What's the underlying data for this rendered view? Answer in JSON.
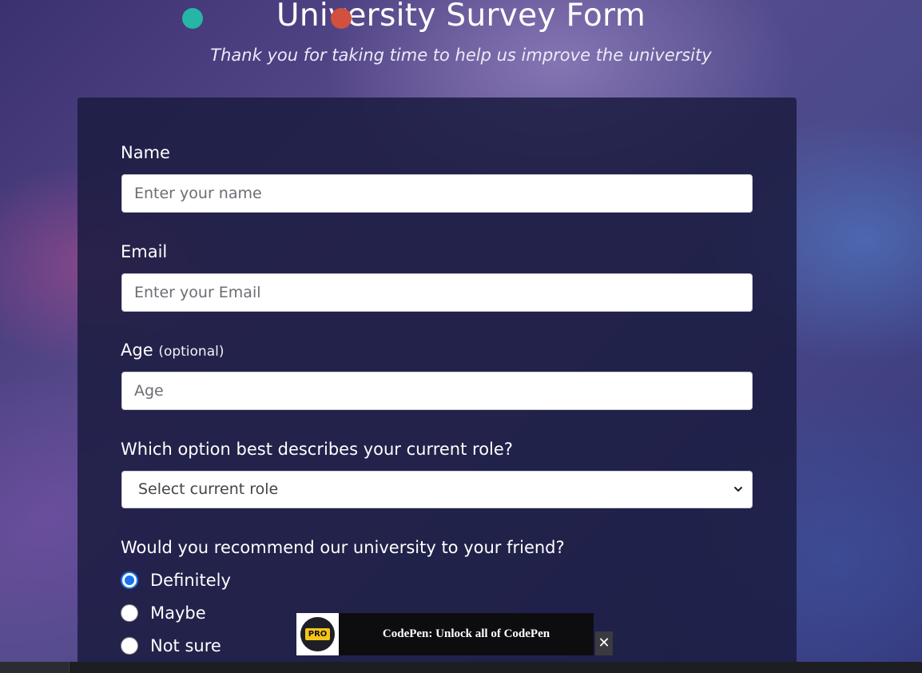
{
  "header": {
    "title": "University Survey Form",
    "subtitle": "Thank you for taking time to help us improve the university"
  },
  "form": {
    "name": {
      "label": "Name",
      "placeholder": "Enter your name",
      "value": ""
    },
    "email": {
      "label": "Email",
      "placeholder": "Enter your Email",
      "value": ""
    },
    "age": {
      "label": "Age",
      "label_hint": "(optional)",
      "placeholder": "Age",
      "value": ""
    },
    "role": {
      "label": "Which option best describes your current role?",
      "selected": "Select current role"
    },
    "recommend": {
      "question": "Would you recommend our university to your friend?",
      "options": [
        {
          "label": "Definitely",
          "checked": true
        },
        {
          "label": "Maybe",
          "checked": false
        },
        {
          "label": "Not sure",
          "checked": false
        }
      ]
    }
  },
  "promo": {
    "badge": "PRO",
    "text": "CodePen: Unlock all of CodePen",
    "close": "✕"
  },
  "colors": {
    "card_background": "#1b1c40",
    "radio_accent": "#1a73e8",
    "promo_badge": "#f5c518"
  },
  "icons": {
    "select_arrow": "chevron-down-icon",
    "promo_close": "close-icon",
    "promo_logo": "codepen-pro-logo"
  }
}
